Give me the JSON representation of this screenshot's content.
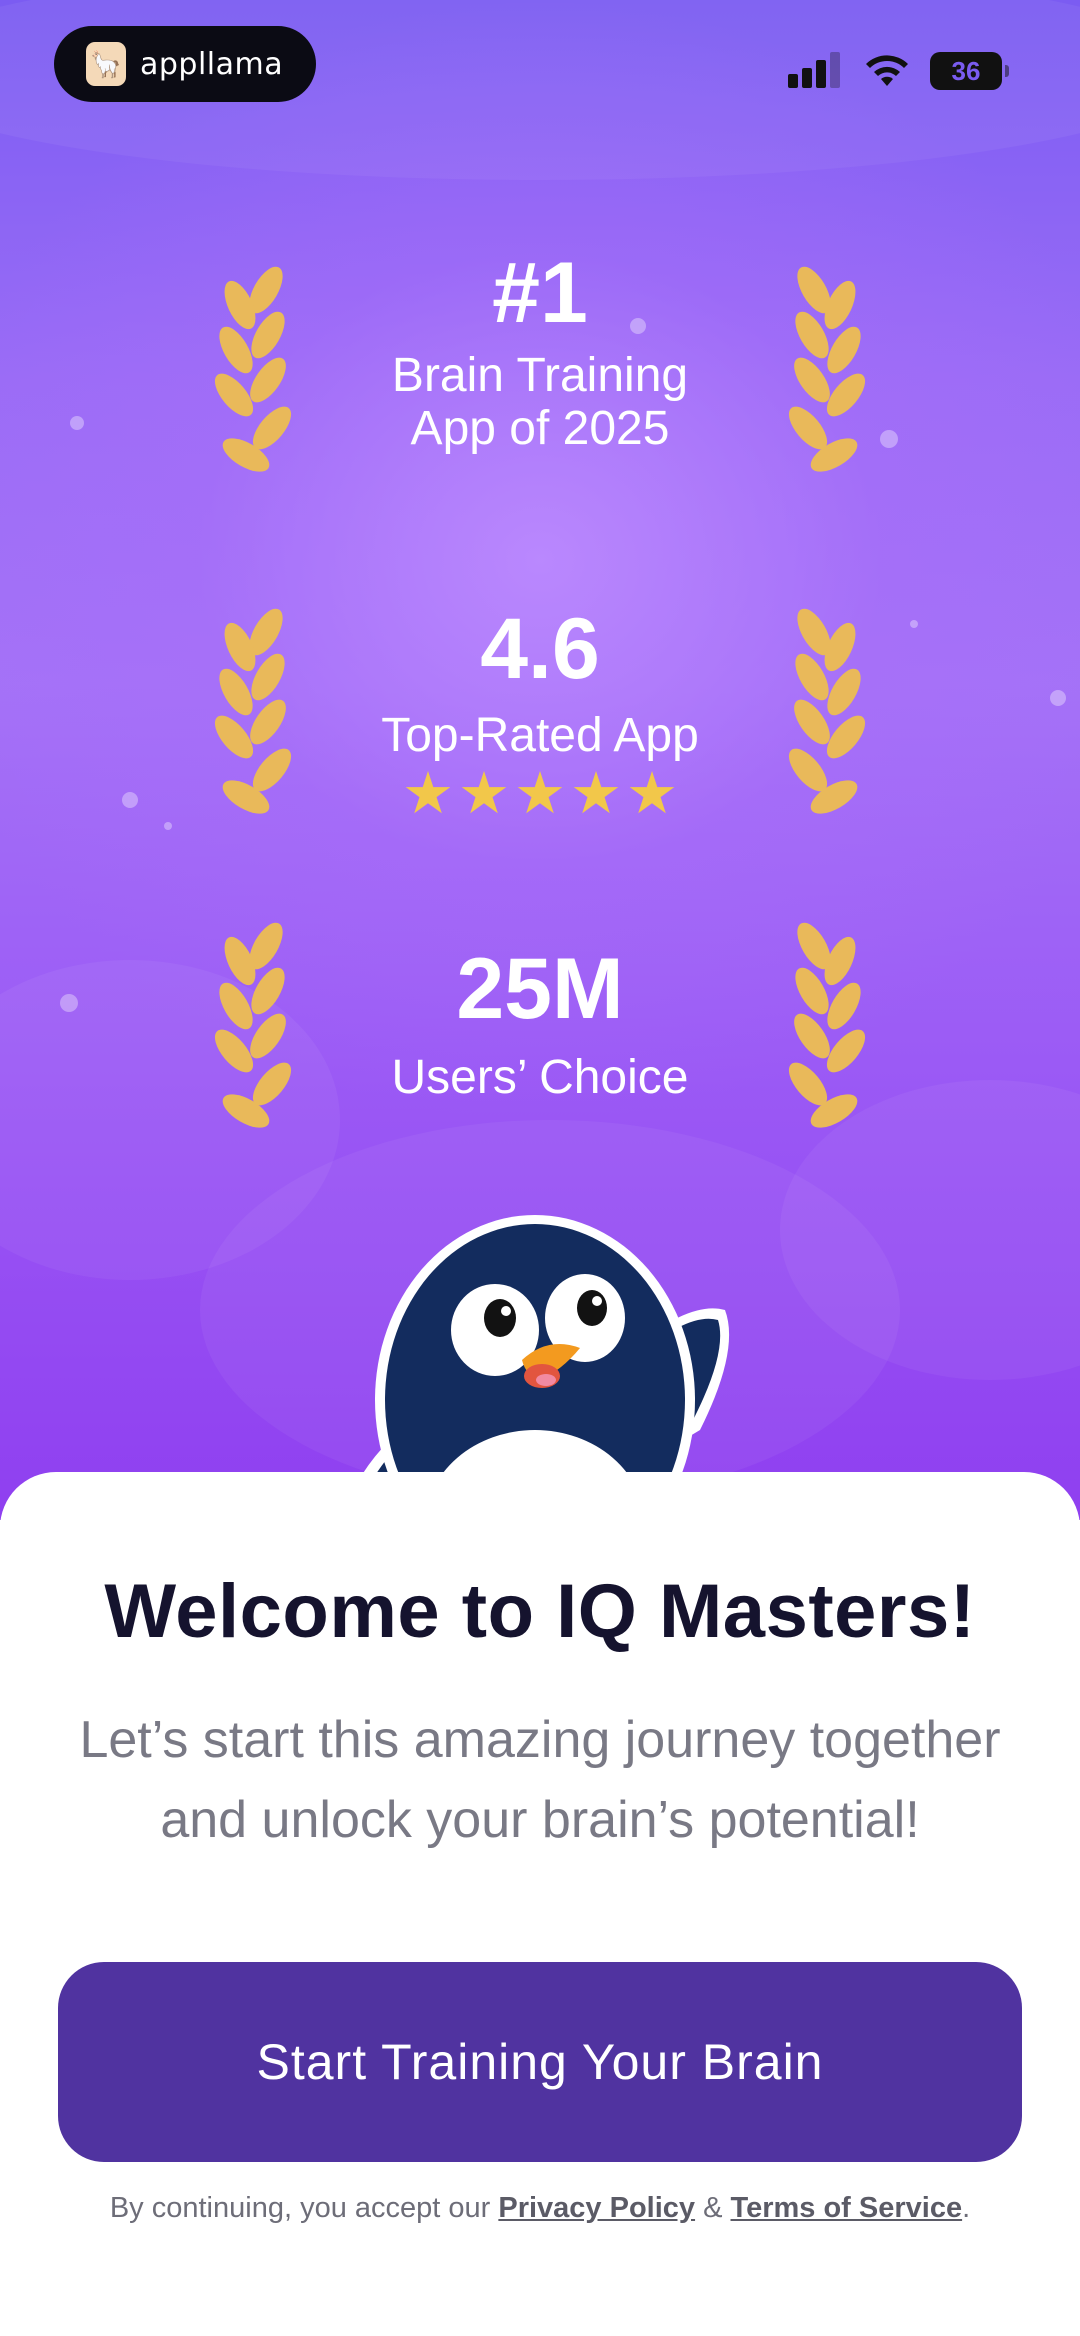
{
  "status_bar": {
    "brand_name": "appllama",
    "battery_level": "36"
  },
  "awards": [
    {
      "headline": "#1",
      "subtitle_line1": "Brain Training",
      "subtitle_line2": "App of 2025"
    },
    {
      "headline": "4.6",
      "subtitle_line1": "Top-Rated App",
      "stars": 5
    },
    {
      "headline": "25M",
      "subtitle_line1": "Users’ Choice"
    }
  ],
  "colors": {
    "accent": "#5033a0",
    "gold": "#f2c74a",
    "hero_top": "#7b5cf2",
    "hero_bottom": "#8f3ff0"
  },
  "welcome": {
    "title": "Welcome to IQ Masters!",
    "tagline_line1": "Let’s start this amazing journey together",
    "tagline_line2": "and unlock your brain’s potential!"
  },
  "cta": {
    "label": "Start Training Your Brain"
  },
  "legal": {
    "prefix": "By continuing, you accept our ",
    "privacy_label": "Privacy Policy",
    "separator": " & ",
    "terms_label": "Terms of Service",
    "suffix": "."
  }
}
